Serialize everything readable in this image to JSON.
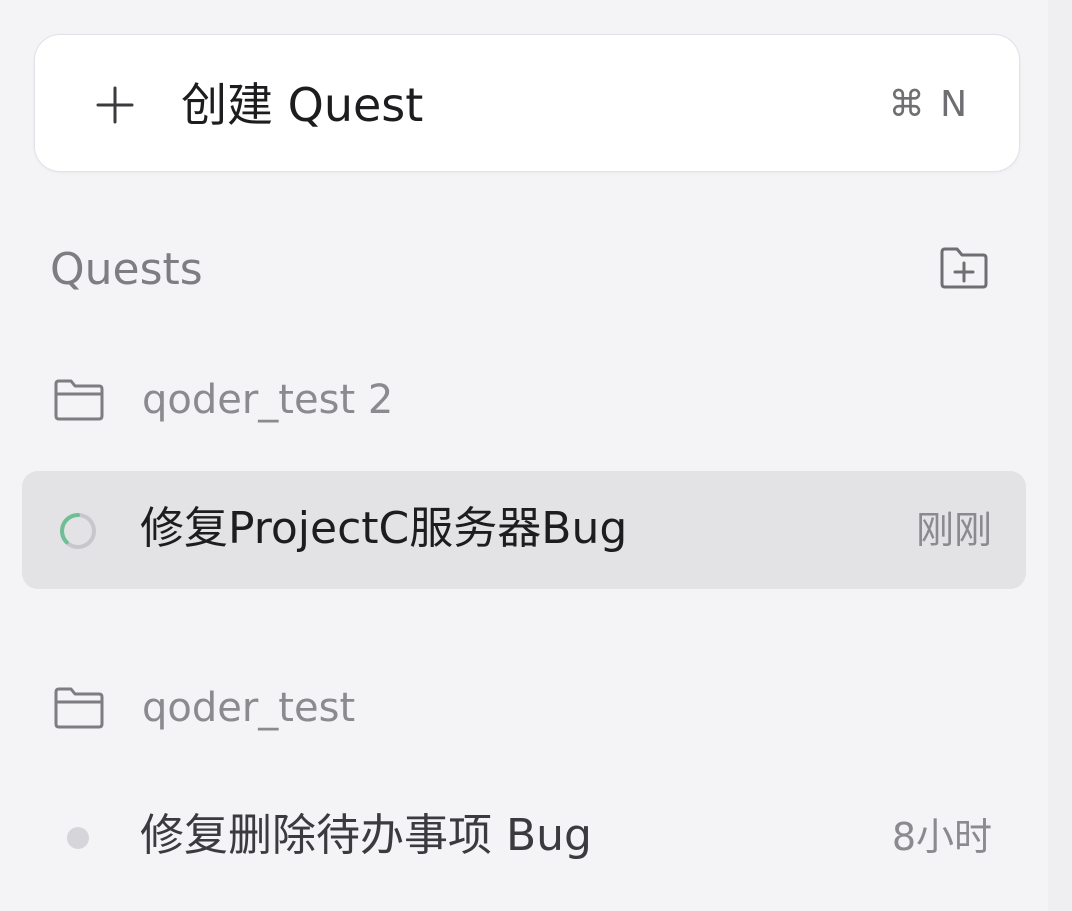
{
  "create_button": {
    "label": "创建 Quest",
    "shortcut": "⌘ N",
    "icon": "plus-icon"
  },
  "quests_section": {
    "title": "Quests",
    "new_folder_icon": "folder-plus-icon"
  },
  "groups": [
    {
      "name": "qoder_test 2",
      "icon": "folder-icon",
      "quests": [
        {
          "title": "修复ProjectC服务器Bug",
          "time": "刚刚",
          "status": "running",
          "active": true
        }
      ]
    },
    {
      "name": "qoder_test",
      "icon": "folder-icon",
      "quests": [
        {
          "title": "修复删除待办事项 Bug",
          "time": "8小时",
          "status": "idle",
          "active": false
        }
      ]
    }
  ],
  "colors": {
    "background": "#f4f4f6",
    "active_row": "#e3e3e6",
    "spinner_accent": "#6fbf95",
    "muted_text": "#8a8a8f"
  }
}
